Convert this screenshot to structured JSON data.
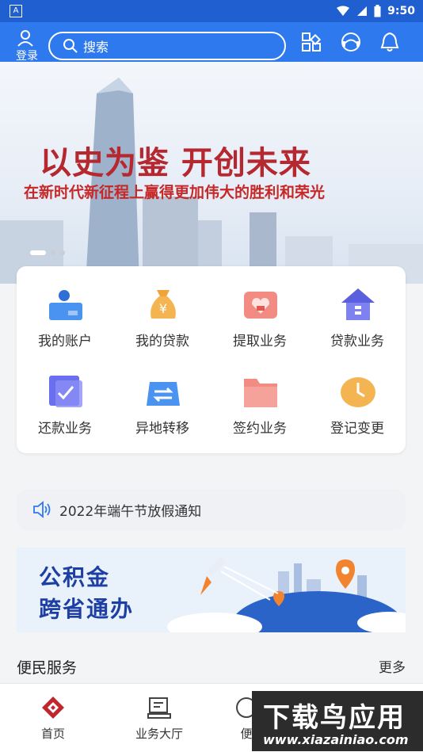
{
  "status_bar": {
    "app_indicator": "A",
    "time": "9:50"
  },
  "header": {
    "login_label": "登录",
    "search_placeholder": "搜索",
    "icons": [
      "scan-icon",
      "customer-service-icon",
      "bell-icon"
    ]
  },
  "banner": {
    "title": "以史为鉴  开创未来",
    "subtitle": "在新时代新征程上赢得更加伟大的胜利和荣光",
    "slide_count": 3,
    "active_slide": 1
  },
  "services": [
    {
      "label": "我的账户",
      "icon": "account-icon"
    },
    {
      "label": "我的贷款",
      "icon": "money-bag-icon"
    },
    {
      "label": "提取业务",
      "icon": "withdraw-icon"
    },
    {
      "label": "贷款业务",
      "icon": "house-icon"
    },
    {
      "label": "还款业务",
      "icon": "repay-icon"
    },
    {
      "label": "异地转移",
      "icon": "transfer-icon"
    },
    {
      "label": "签约业务",
      "icon": "folder-icon"
    },
    {
      "label": "登记变更",
      "icon": "clock-icon"
    }
  ],
  "notice": {
    "text": "2022年端午节放假通知"
  },
  "promo": {
    "line1": "公积金",
    "line2": "跨省通办"
  },
  "section": {
    "title": "便民服务",
    "more": "更多"
  },
  "bottom_nav": [
    {
      "label": "首页",
      "icon": "home-icon"
    },
    {
      "label": "业务大厅",
      "icon": "hall-icon"
    },
    {
      "label": "便",
      "icon": "convenience-icon"
    }
  ],
  "watermark": {
    "line1": "下载鸟应用",
    "line2": "www.xiazainiao.com"
  },
  "colors": {
    "primary": "#2f79ee",
    "banner_red": "#b6282f"
  }
}
